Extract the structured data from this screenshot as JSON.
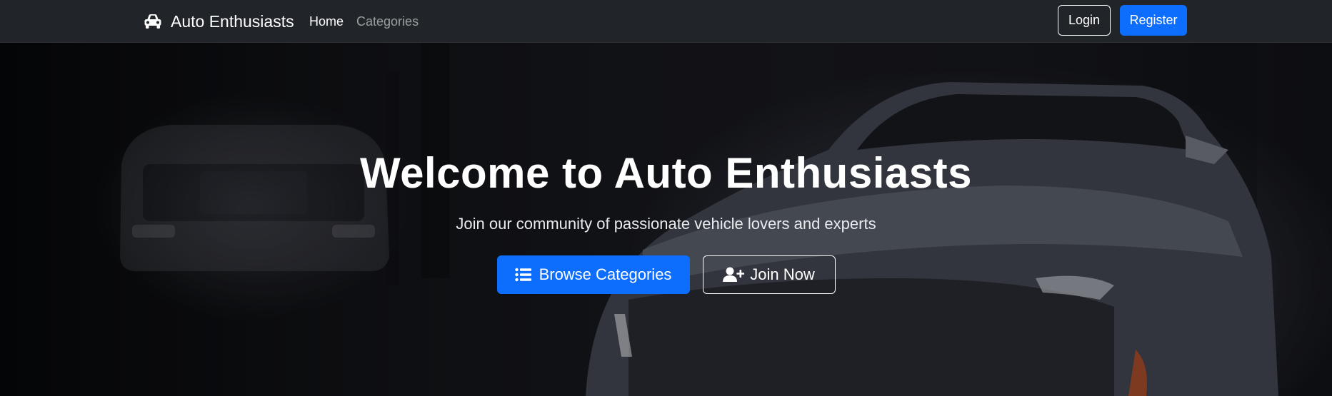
{
  "navbar": {
    "brand": {
      "icon": "car-icon",
      "label": "Auto Enthusiasts"
    },
    "links": [
      {
        "label": "Home",
        "active": true
      },
      {
        "label": "Categories",
        "active": false
      }
    ],
    "login_label": "Login",
    "register_label": "Register"
  },
  "hero": {
    "title": "Welcome to Auto Enthusiasts",
    "subtitle": "Join our community of passionate vehicle lovers and experts",
    "browse_button": {
      "icon": "list-icon",
      "label": "Browse Categories"
    },
    "join_button": {
      "icon": "user-plus-icon",
      "label": "Join Now"
    }
  },
  "colors": {
    "navbar_bg": "#212529",
    "primary": "#0d6efd",
    "text_light": "#ffffff",
    "nav_muted": "rgba(255,255,255,0.55)"
  }
}
